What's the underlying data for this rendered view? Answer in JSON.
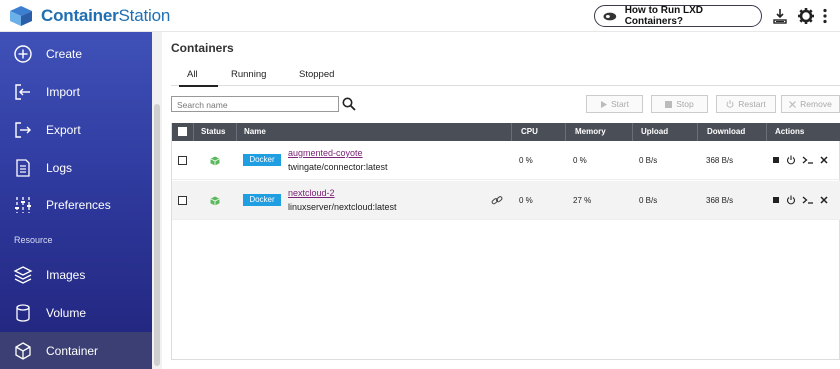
{
  "app": {
    "title_bold": "Container",
    "title_rest": "Station"
  },
  "header": {
    "lxd_button": "How to Run LXD Containers?"
  },
  "sidebar": {
    "items": [
      {
        "label": "Create",
        "icon": "plus-circle-icon"
      },
      {
        "label": "Import",
        "icon": "import-icon"
      },
      {
        "label": "Export",
        "icon": "export-icon"
      },
      {
        "label": "Logs",
        "icon": "document-icon"
      },
      {
        "label": "Preferences",
        "icon": "sliders-icon"
      }
    ],
    "section": "Resource",
    "resource_items": [
      {
        "label": "Images",
        "icon": "layers-icon"
      },
      {
        "label": "Volume",
        "icon": "database-icon"
      },
      {
        "label": "Container",
        "icon": "cube-icon",
        "active": true
      }
    ]
  },
  "main": {
    "title": "Containers",
    "tabs": [
      "All",
      "Running",
      "Stopped"
    ],
    "active_tab": "All",
    "search_placeholder": "Search name",
    "actions": [
      "Start",
      "Stop",
      "Restart",
      "Remove"
    ]
  },
  "table": {
    "columns": [
      "Status",
      "Name",
      "CPU",
      "Memory",
      "Upload",
      "Download",
      "Actions"
    ],
    "rows": [
      {
        "type": "Docker",
        "name": "augmented-coyote",
        "image": "twingate/connector:latest",
        "cpu": "0 %",
        "memory": "0 %",
        "upload": "0 B/s",
        "download": "368 B/s",
        "link": false
      },
      {
        "type": "Docker",
        "name": "nextcloud-2",
        "image": "linuxserver/nextcloud:latest",
        "cpu": "0 %",
        "memory": "27 %",
        "upload": "0 B/s",
        "download": "368 B/s",
        "link": true
      }
    ]
  },
  "colors": {
    "accent": "#1f6fb2",
    "docker": "#1f9ee2",
    "status_running": "#5cb85c",
    "link": "#7a2277"
  }
}
